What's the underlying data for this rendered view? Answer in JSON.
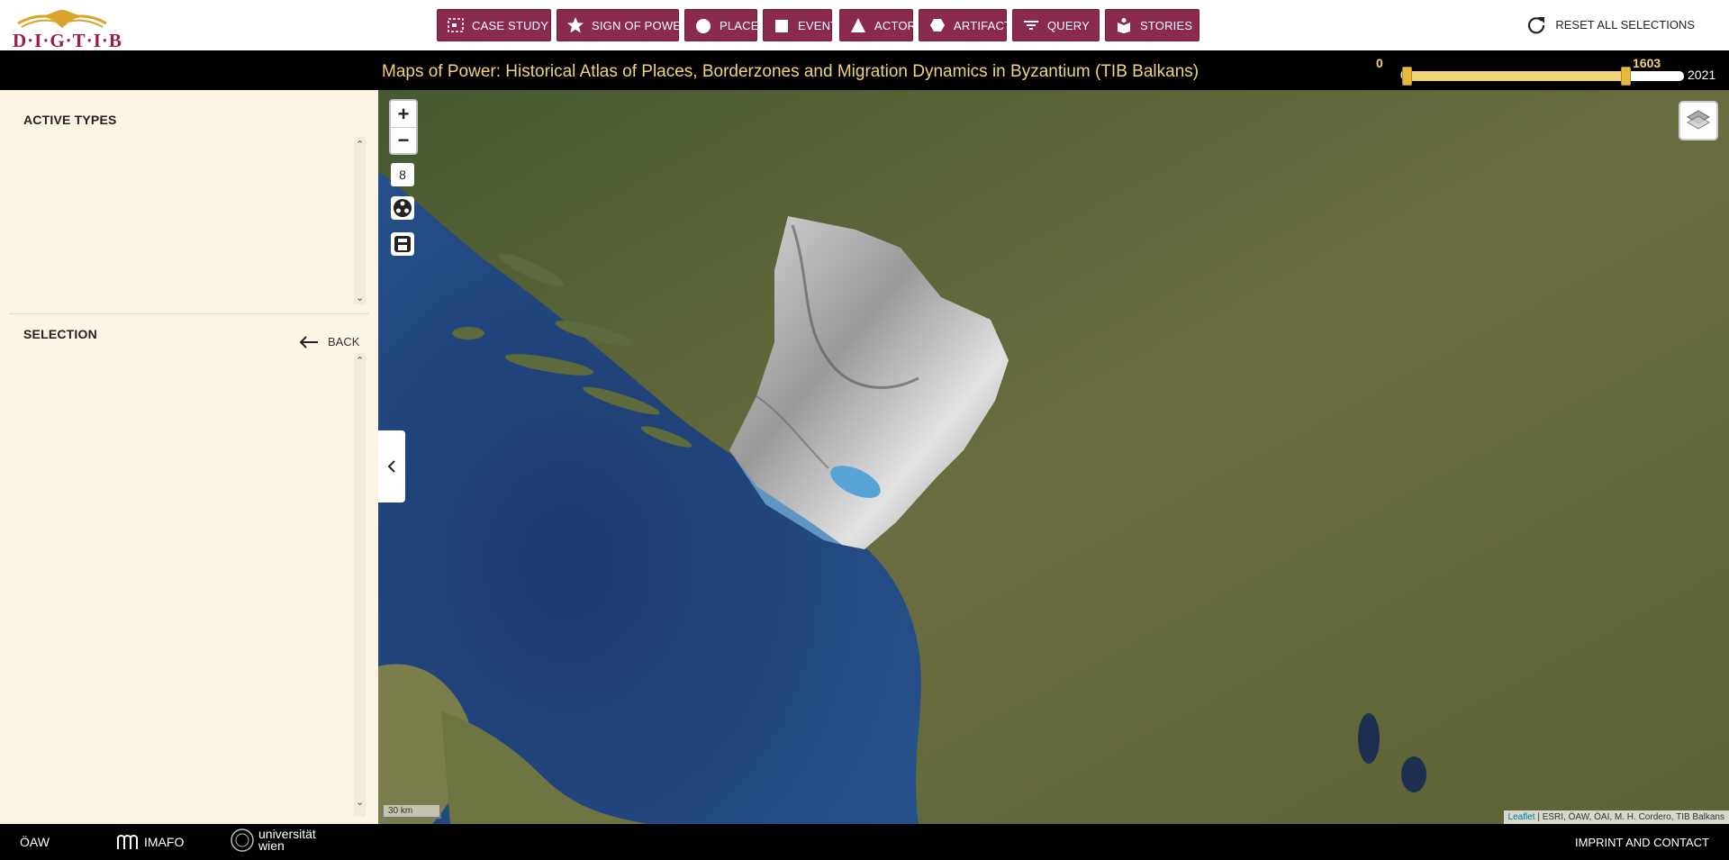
{
  "header": {
    "logo_text": "D·I·G·T·I·B",
    "reset_label": "RESET ALL SELECTIONS",
    "nav": [
      {
        "label": "CASE STUDY",
        "icon": "case-study-icon"
      },
      {
        "label": "SIGN OF POWER",
        "icon": "star-icon"
      },
      {
        "label": "PLACE",
        "icon": "circle-icon"
      },
      {
        "label": "EVENT",
        "icon": "square-icon"
      },
      {
        "label": "ACTOR",
        "icon": "triangle-icon"
      },
      {
        "label": "ARTIFACT",
        "icon": "hexagon-icon"
      },
      {
        "label": "QUERY",
        "icon": "filter-icon"
      },
      {
        "label": "STORIES",
        "icon": "stories-icon"
      }
    ]
  },
  "titlebar": {
    "title": "Maps of Power: Historical Atlas of Places, Borderzones and Migration Dynamics in Byzantium (TIB Balkans)"
  },
  "timeline": {
    "range_start": "0",
    "range_end": "2021",
    "selected_min": "0",
    "selected_max": "1603",
    "selected_min_value": 0,
    "selected_max_value": 1603,
    "range_end_value": 2021
  },
  "sidebar": {
    "active_types_heading": "ACTIVE TYPES",
    "selection_heading": "SELECTION",
    "back_label": "BACK"
  },
  "map": {
    "zoom_in": "+",
    "zoom_out": "−",
    "zoom_level": "8",
    "scale_label": "30 km",
    "attribution_link": "Leaflet",
    "attribution_text": " | ESRI, ÖAW, ÖAI, M. H. Cordero, TIB Balkans"
  },
  "footer": {
    "logo_oaw": "ÖAW",
    "logo_imafo": "IMAFO",
    "logo_univie": "universität wien",
    "imprint_label": "IMPRINT AND CONTACT"
  },
  "colors": {
    "nav_button": "#8a2a4f",
    "title_text": "#f2d37a",
    "sidebar_bg": "#fcf4e4",
    "sea": "#1c3d72"
  }
}
